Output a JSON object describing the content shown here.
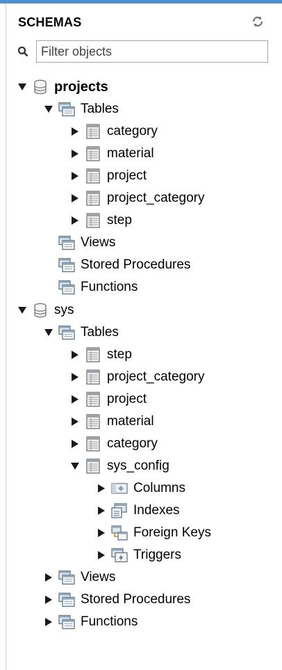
{
  "panel": {
    "title": "SCHEMAS",
    "filter_placeholder": "Filter objects"
  },
  "tree": {
    "projects": {
      "name": "projects",
      "tables_label": "Tables",
      "tables": [
        "category",
        "material",
        "project",
        "project_category",
        "step"
      ],
      "views_label": "Views",
      "procedures_label": "Stored Procedures",
      "functions_label": "Functions"
    },
    "sys": {
      "name": "sys",
      "tables_label": "Tables",
      "tables": [
        "step",
        "project_category",
        "project",
        "material",
        "category",
        "sys_config"
      ],
      "sys_config_children": [
        "Columns",
        "Indexes",
        "Foreign Keys",
        "Triggers"
      ],
      "views_label": "Views",
      "procedures_label": "Stored Procedures",
      "functions_label": "Functions"
    }
  },
  "colors": {
    "accent": "#4f8fd8",
    "arrow": "#1a1a1a"
  }
}
